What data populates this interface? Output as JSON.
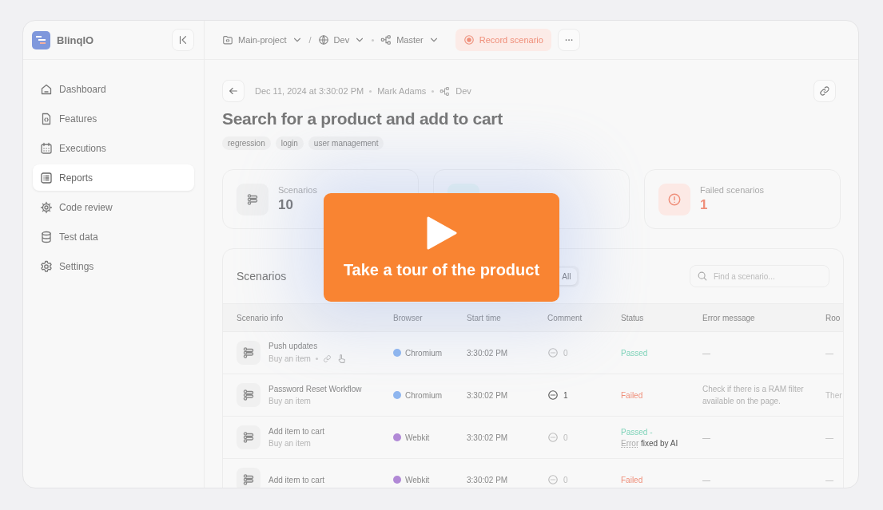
{
  "sidebar": {
    "logo": "BlinqIO",
    "items": [
      {
        "label": "Dashboard",
        "kind": "home",
        "selected": false
      },
      {
        "label": "Features",
        "kind": "file",
        "selected": false
      },
      {
        "label": "Executions",
        "kind": "calendar",
        "selected": false
      },
      {
        "label": "Reports",
        "kind": "list",
        "selected": true
      },
      {
        "label": "Code review",
        "kind": "gear",
        "selected": false
      },
      {
        "label": "Test data",
        "kind": "database",
        "selected": false
      },
      {
        "label": "Settings",
        "kind": "settings",
        "selected": false
      }
    ]
  },
  "topbar": {
    "project": "Main-project",
    "separator": "/",
    "environment": "Dev",
    "branch": "Master",
    "record_button": "Record scenario"
  },
  "report": {
    "date": "Dec 11, 2024 at 3:30:02 PM",
    "author": "Mark Adams",
    "environment": "Dev",
    "title": "Search for a product and add to cart",
    "tags": [
      "regression",
      "login",
      "user management"
    ]
  },
  "stats": [
    {
      "kind": "total",
      "label": "Scenarios",
      "value": "10"
    },
    {
      "kind": "passed"
    },
    {
      "kind": "failed",
      "label": "Failed scenarios",
      "value": "1"
    }
  ],
  "scenarios": {
    "title": "Scenarios",
    "filters": [
      {
        "label": "All",
        "selected": true
      }
    ],
    "search": {
      "placeholder": "Find a scenario..."
    },
    "columns": [
      "Scenario info",
      "Browser",
      "Start time",
      "Comment",
      "Status",
      "Error message",
      "Roo"
    ],
    "rows": [
      {
        "name": "Push updates",
        "flow": "Buy an item",
        "link": true,
        "browser": "Chromium",
        "color": "#8fb6ef",
        "start": "3:30:02 PM",
        "comments": "0",
        "highlighted": false,
        "kind": "passed",
        "status": "Passed",
        "error": "—",
        "root": "—"
      },
      {
        "name": "Password Reset Workflow",
        "flow": "Buy an item",
        "link": false,
        "browser": "Chromium",
        "color": "#8fb6ef",
        "start": "3:30:02 PM",
        "comments": "1",
        "highlighted": true,
        "kind": "failed",
        "status": "Failed",
        "error": "Check if there is a RAM filter available on the page.",
        "root": "Ther"
      },
      {
        "name": "Add item to cart",
        "flow": "Buy an item",
        "link": false,
        "browser": "Webkit",
        "color": "#b189d6",
        "start": "3:30:02 PM",
        "comments": "0",
        "highlighted": false,
        "kind": "fixed",
        "status": "Passed -",
        "fix_error": "Error",
        "fix_note": "fixed by AI",
        "error": "—",
        "root": "—"
      },
      {
        "name": "Add item to cart",
        "browser": "Webkit",
        "color": "#b189d6",
        "start": "3:30:02 PM",
        "comments": "0",
        "highlighted": false,
        "kind": "failed",
        "status": "Failed",
        "error": "—",
        "root": "—"
      }
    ]
  },
  "tour": {
    "label": "Take a tour of the product"
  }
}
